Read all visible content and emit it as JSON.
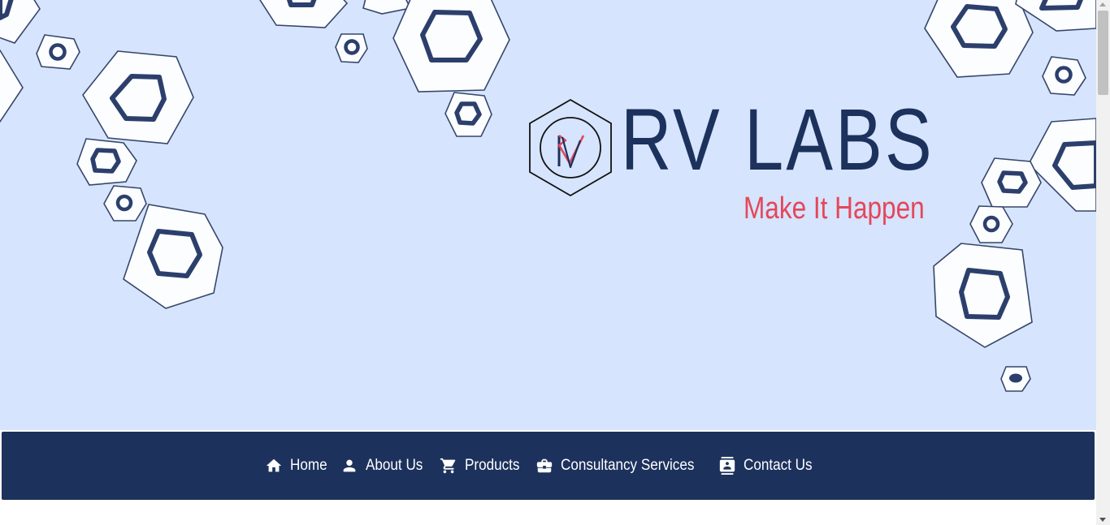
{
  "brand": {
    "title": "RV LABS",
    "tagline": "Make It Happen",
    "logo_icon": "rv-hexagon-logo-icon",
    "primary_color": "#1c325d",
    "accent_color": "#e4475a",
    "background_color": "#d6e4fd"
  },
  "nav": {
    "items": [
      {
        "label": "Home",
        "icon": "home-icon"
      },
      {
        "label": "About Us",
        "icon": "person-icon"
      },
      {
        "label": "Products",
        "icon": "cart-icon"
      },
      {
        "label": "Consultancy Services",
        "icon": "briefcase-icon"
      },
      {
        "label": "Contact Us",
        "icon": "contact-card-icon"
      }
    ]
  }
}
